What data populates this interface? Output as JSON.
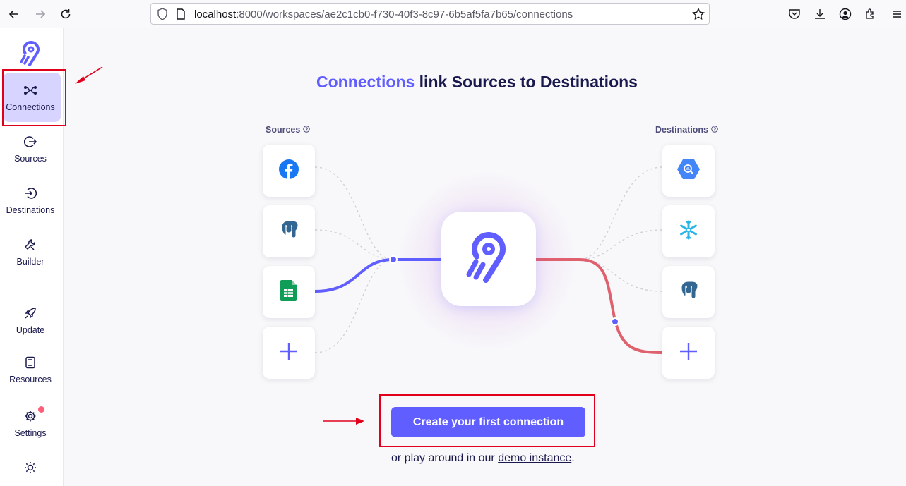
{
  "browser": {
    "url_host": "localhost",
    "url_rest": ":8000/workspaces/ae2c1cb0-f730-40f3-8c97-6b5af5fa7b65/connections",
    "icons": [
      "back-arrow-icon",
      "forward-arrow-icon",
      "reload-icon",
      "shield-icon",
      "page-icon",
      "bookmark-star-icon",
      "pocket-icon",
      "download-icon",
      "account-icon",
      "extensions-icon",
      "menu-icon"
    ]
  },
  "sidebar": {
    "items": [
      {
        "label": "Connections",
        "icon": "connections-icon",
        "active": true
      },
      {
        "label": "Sources",
        "icon": "sources-icon"
      },
      {
        "label": "Destinations",
        "icon": "destinations-icon"
      },
      {
        "label": "Builder",
        "icon": "builder-icon"
      },
      {
        "label": "Update",
        "icon": "rocket-icon"
      },
      {
        "label": "Resources",
        "icon": "book-icon"
      },
      {
        "label": "Settings",
        "icon": "gear-icon",
        "badge": true
      },
      {
        "label": "",
        "icon": "sun-icon"
      }
    ]
  },
  "main": {
    "headline_accent": "Connections",
    "headline_rest": " link Sources to Destinations",
    "sources_label": "Sources",
    "destinations_label": "Destinations",
    "sources": [
      "facebook-icon",
      "postgres-icon",
      "google-sheets-icon",
      "plus-icon"
    ],
    "destinations": [
      "bigquery-icon",
      "snowflake-icon",
      "postgres-icon",
      "plus-icon"
    ],
    "cta_label": "Create your first connection",
    "demo_prefix": "or play around in our ",
    "demo_link": "demo instance",
    "demo_suffix": "."
  },
  "colors": {
    "accent": "#615eff",
    "dark": "#1a194d",
    "destination_line": "#e0616e",
    "annotation": "#e0001c"
  }
}
